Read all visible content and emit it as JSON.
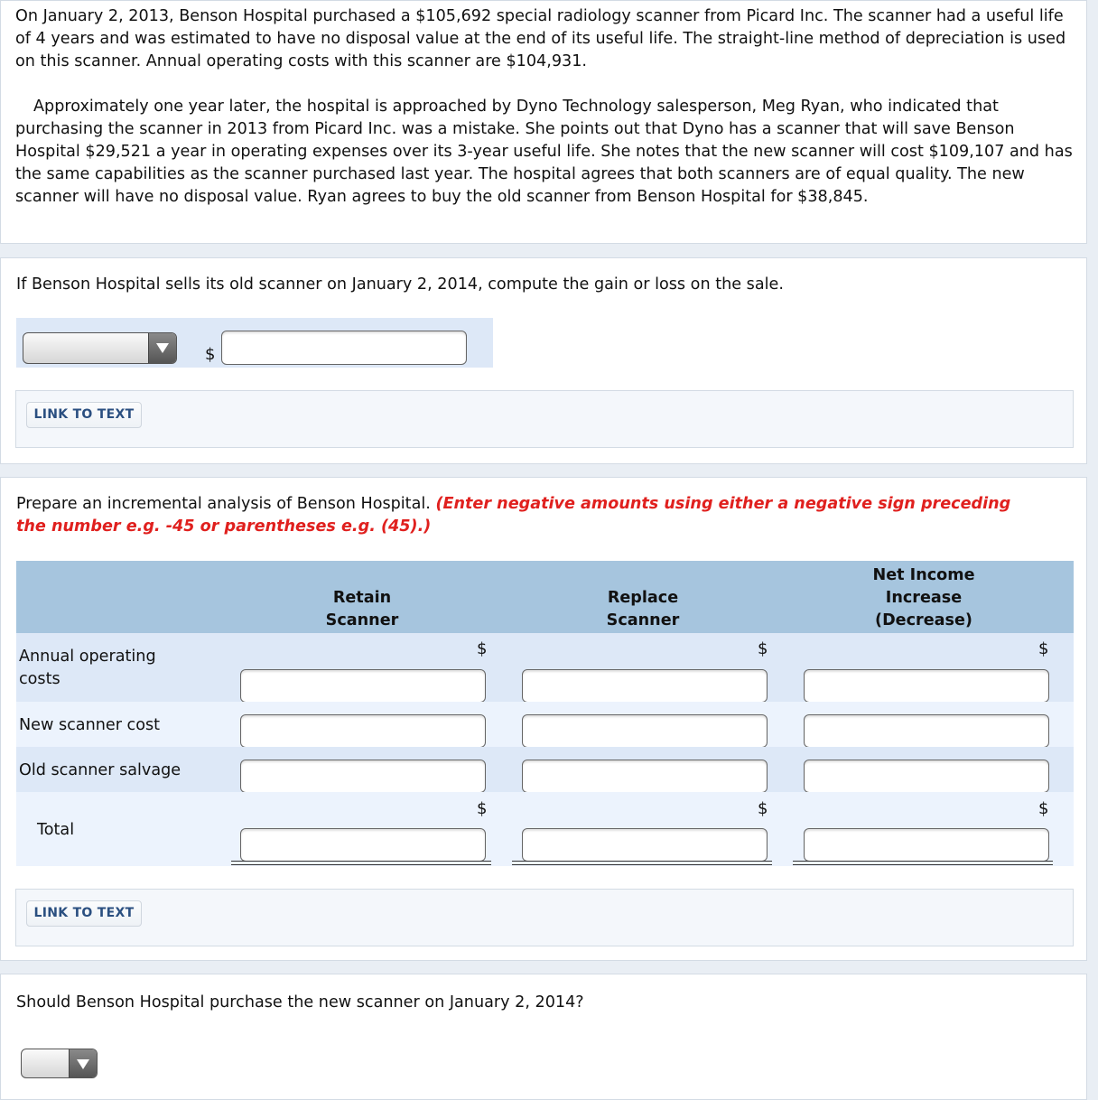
{
  "problem": {
    "paragraph1": "On January 2, 2013, Benson Hospital purchased a $105,692 special radiology scanner from Picard Inc. The scanner had a useful life of 4 years and was estimated to have no disposal value at the end of its useful life. The straight-line method of depreciation is used on this scanner. Annual operating costs with this scanner are $104,931.",
    "paragraph2": "Approximately one year later, the hospital is approached by Dyno Technology salesperson, Meg Ryan, who indicated that purchasing the scanner in 2013 from Picard Inc. was a mistake. She points out that Dyno has a scanner that will save Benson Hospital $29,521 a year in operating expenses over its 3-year useful life. She notes that the new scanner will cost $109,107 and has the same capabilities as the scanner purchased last year. The hospital agrees that both scanners are of equal quality. The new scanner will have no disposal value. Ryan agrees to buy the old scanner from Benson Hospital for $38,845."
  },
  "part1": {
    "question": "If Benson Hospital sells its old scanner on January 2, 2014, compute the gain or loss on the sale.",
    "gain_loss_select": "",
    "currency": "$",
    "amount_value": "",
    "link_label": "LINK TO TEXT"
  },
  "part2": {
    "question": "Prepare an incremental analysis of Benson Hospital.",
    "instruction": "(Enter negative amounts using either a negative sign preceding the number e.g. -45 or parentheses e.g. (45).)",
    "columns": [
      {
        "line1": "",
        "line2": "Retain",
        "line3": "Scanner"
      },
      {
        "line1": "",
        "line2": "Replace",
        "line3": "Scanner"
      },
      {
        "line1": "Net Income",
        "line2": "Increase",
        "line3": "(Decrease)"
      }
    ],
    "currency": "$",
    "rows": [
      {
        "label": "Annual operating costs",
        "values": [
          "",
          "",
          ""
        ]
      },
      {
        "label": "New scanner cost",
        "values": [
          "",
          "",
          ""
        ]
      },
      {
        "label": "Old scanner salvage",
        "values": [
          "",
          "",
          ""
        ]
      },
      {
        "label": "Total",
        "values": [
          "",
          "",
          ""
        ]
      }
    ],
    "link_label": "LINK TO TEXT"
  },
  "part3": {
    "question": "Should Benson Hospital purchase the new scanner on January 2, 2014?",
    "answer_select": ""
  }
}
